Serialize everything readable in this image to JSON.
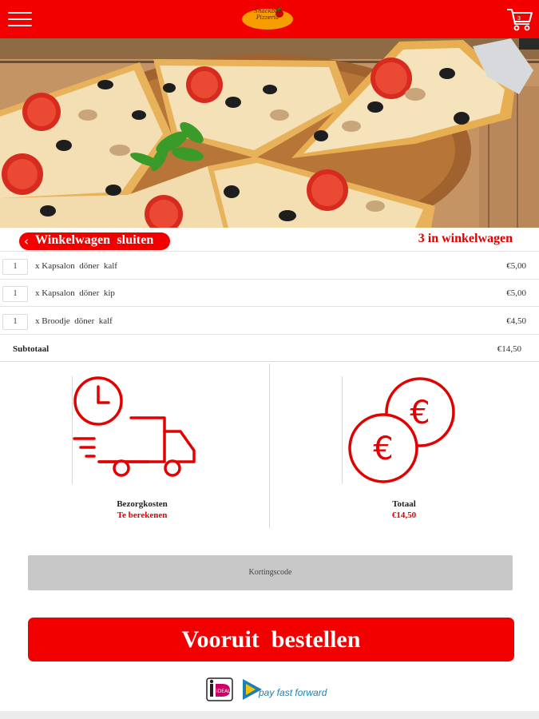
{
  "header": {
    "logo_text": "Snackbar\nPizzeria",
    "cart_badge": "3",
    "colors": {
      "brand_red": "#f20000"
    },
    "icons": {
      "menu": "hamburger-icon",
      "cart": "cart-icon"
    }
  },
  "cart": {
    "close_label": "Winkelwagen  sluiten",
    "close_icon": "chevron-left-icon",
    "count_text": "3 in winkelwagen",
    "items": [
      {
        "qty": "1",
        "name": "x Kapsalon  döner  kalf",
        "price": "€5,00"
      },
      {
        "qty": "1",
        "name": "x Kapsalon  döner  kip",
        "price": "€5,00"
      },
      {
        "qty": "1",
        "name": "x Broodje  döner  kalf",
        "price": "€4,50"
      }
    ],
    "subtotal_label": "Subtotaal",
    "subtotal_value": "€14,50"
  },
  "delivery": {
    "label": "Bezorgkosten",
    "value": "Te berekenen",
    "icon": "delivery-truck-icon"
  },
  "total": {
    "label": "Totaal",
    "value": "€14,50",
    "icon": "euro-coins-icon"
  },
  "coupon": {
    "label": "Kortingscode"
  },
  "order_button": {
    "label": "Vooruit  bestellen"
  },
  "payment": {
    "ideal_label": "iDEAL",
    "pff_label": "pay fast forward"
  }
}
